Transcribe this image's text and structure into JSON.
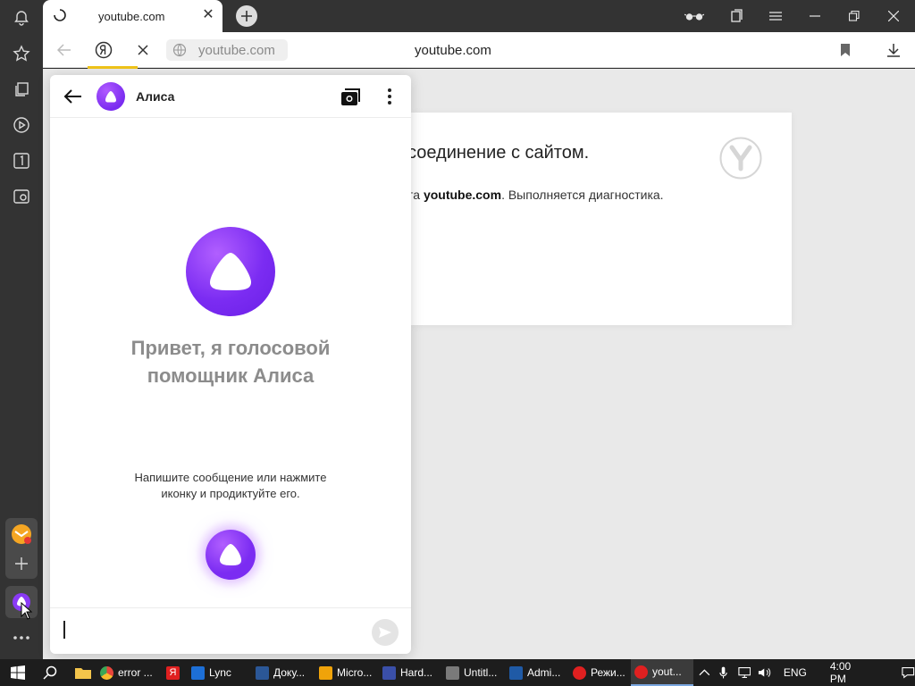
{
  "browser": {
    "tab": {
      "title": "youtube.com",
      "close": "✕"
    },
    "address": {
      "pill_text": "youtube.com",
      "center_title": "youtube.com"
    }
  },
  "error_card": {
    "heading": "соединение с сайтом.",
    "desc_prefix": "та ",
    "desc_domain": "youtube.com",
    "desc_suffix": ". Выполняется диагностика."
  },
  "alice": {
    "name": "Алиса",
    "greeting_line1": "Привет, я голосовой",
    "greeting_line2": "помощник Алиса",
    "hint_line1": "Напишите сообщение или нажмите",
    "hint_line2": "иконку и продиктуйте его.",
    "input_value": ""
  },
  "taskbar": {
    "items": [
      {
        "label": "error ...",
        "color": "#e8453c"
      },
      {
        "label": "",
        "color": "#e8453c"
      },
      {
        "label": "Lync",
        "color": "#1d6fd6"
      },
      {
        "label": "Доку...",
        "color": "#2b5797"
      },
      {
        "label": "Micro...",
        "color": "#f0a30a"
      },
      {
        "label": "Hard...",
        "color": "#3a4fa8"
      },
      {
        "label": "Untitl...",
        "color": "#7a7a7a"
      },
      {
        "label": "Admi...",
        "color": "#1f5aa6"
      },
      {
        "label": "Режи...",
        "color": "#e02020"
      },
      {
        "label": "yout...",
        "color": "#e02020"
      }
    ],
    "lang": "ENG",
    "time": "4:00 PM"
  },
  "colors": {
    "alice_purple": "#7b2cf2",
    "loading_bar": "#f0c419",
    "sidebar": "#333333"
  }
}
